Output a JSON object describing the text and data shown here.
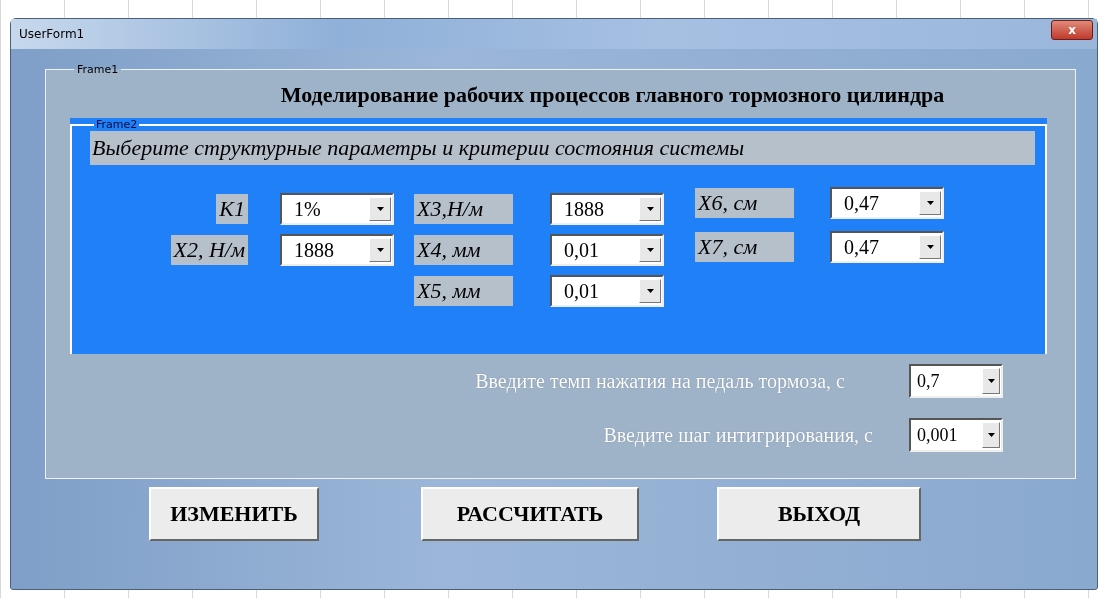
{
  "window": {
    "title": "UserForm1",
    "close": "x"
  },
  "frame1": {
    "caption": "Frame1",
    "heading": "Моделирование рабочих процессов главного тормозного цилиндра"
  },
  "frame2": {
    "caption": "Frame2",
    "prompt": "Выберите структурные параметры и критерии состояния системы",
    "param_columns": [
      [
        {
          "label": "K1",
          "value": "1%"
        },
        {
          "label": "X2, Н/м",
          "value": "1888"
        }
      ],
      [
        {
          "label": "X3,Н/м",
          "value": "1888"
        },
        {
          "label": "X4, мм",
          "value": "0,01"
        },
        {
          "label": "X5, мм",
          "value": "0,01"
        }
      ],
      [
        {
          "label": "X6, см",
          "value": "0,47"
        },
        {
          "label": "X7, см",
          "value": "0,47"
        }
      ]
    ]
  },
  "inputs": [
    {
      "label": "Введите темп нажатия на педаль тормоза, с",
      "value": "0,7"
    },
    {
      "label": "Введите шаг интигрирования, с",
      "value": "0,001"
    }
  ],
  "buttons": [
    "ИЗМЕНИТЬ",
    "РАССЧИТАТЬ",
    "ВЫХОД"
  ]
}
